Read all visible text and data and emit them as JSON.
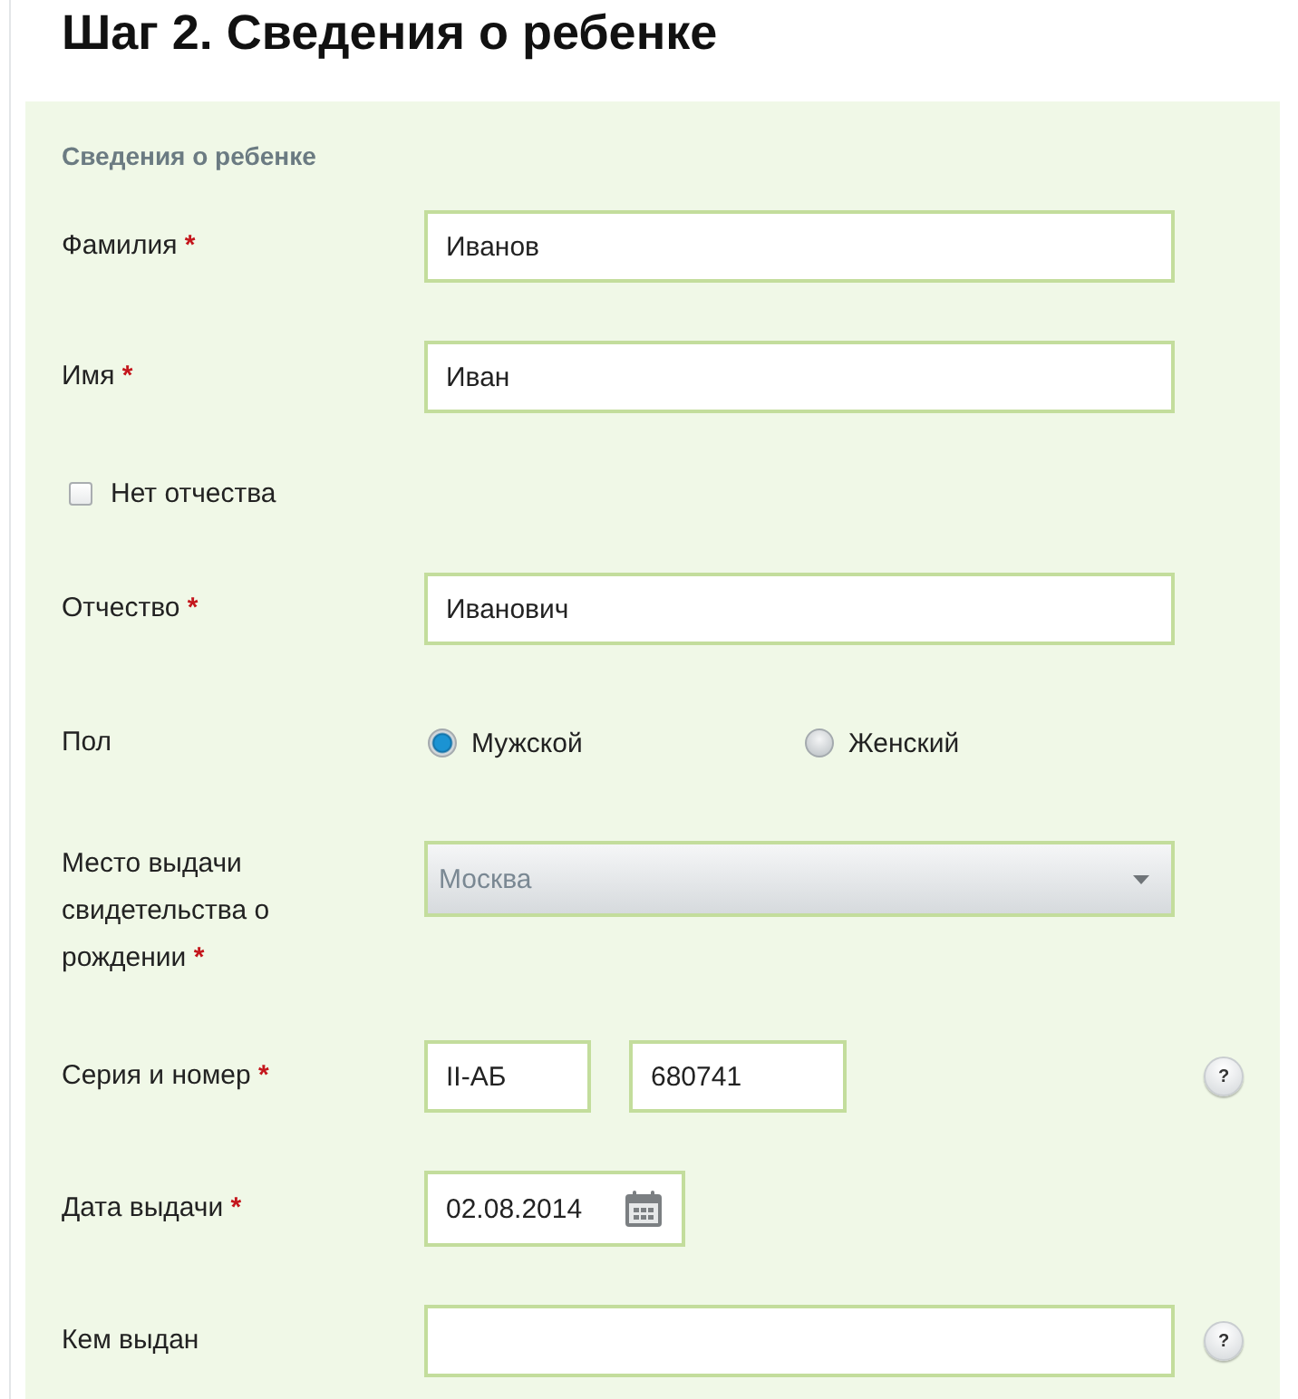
{
  "page_title": "Шаг 2. Сведения о ребенке",
  "section": {
    "title": "Сведения о ребенке",
    "fields": [
      {
        "kind": "text",
        "label": "Фамилия",
        "required_mark": "*",
        "value": "Иванов"
      },
      {
        "kind": "text",
        "label": "Имя",
        "required_mark": "*",
        "value": "Иван"
      },
      {
        "kind": "checkbox",
        "label": "Нет отчества",
        "checked": false
      },
      {
        "kind": "text",
        "label": "Отчество",
        "required_mark": "*",
        "value": "Иванович"
      },
      {
        "kind": "radio",
        "label": "Пол",
        "options": [
          {
            "label": "Мужской",
            "selected": true
          },
          {
            "label": "Женский",
            "selected": false
          }
        ]
      },
      {
        "kind": "select",
        "label": "Место выдачи свидетельства о рождении",
        "required_mark": "*",
        "value": "Москва"
      },
      {
        "kind": "series",
        "label": "Серия и номер",
        "required_mark": "*",
        "values": [
          "II-АБ",
          "680741"
        ],
        "help": "?"
      },
      {
        "kind": "date",
        "label": "Дата выдачи",
        "required_mark": "*",
        "value": "02.08.2014"
      },
      {
        "kind": "text",
        "label": "Кем выдан",
        "help": "?"
      }
    ]
  }
}
